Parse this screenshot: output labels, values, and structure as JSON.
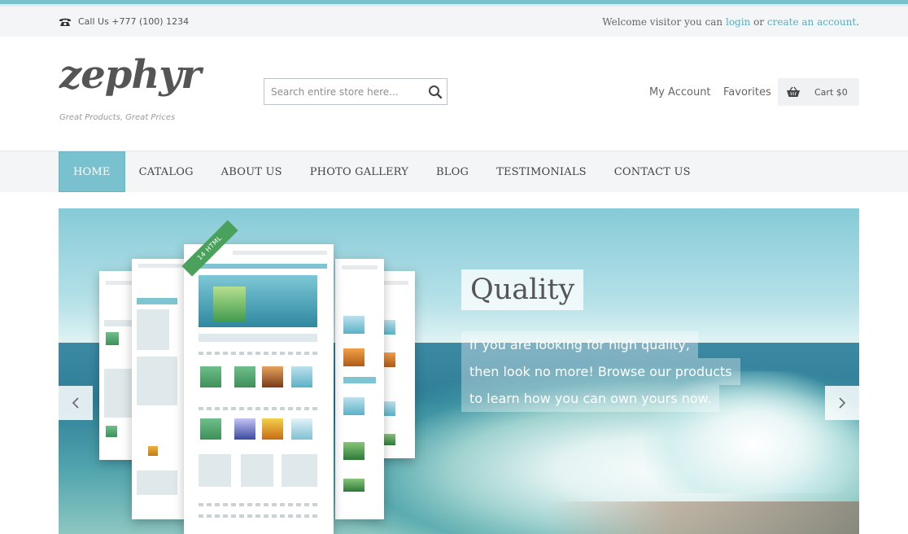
{
  "topbar": {
    "phone": "Call Us +777 (100) 1234",
    "welcome_prefix": "Welcome visitor you can",
    "login": "login",
    "or": "or",
    "create_account": "create an account",
    "period": "."
  },
  "header": {
    "logo": "zephyr",
    "tagline": "Great Products, Great Prices",
    "search_placeholder": "Search entire store here...",
    "my_account": "My Account",
    "favorites": "Favorites",
    "cart": "Cart $0"
  },
  "nav": {
    "items": [
      "HOME",
      "CATALOG",
      "ABOUT US",
      "PHOTO GALLERY",
      "BLOG",
      "TESTIMONIALS",
      "CONTACT US"
    ],
    "active": "HOME"
  },
  "slider": {
    "title": "Quality",
    "lines": [
      "If you are looking for high quality,",
      "then look no more! Browse our products",
      "to learn how you can own yours now."
    ],
    "ribbon": "14 HTML"
  },
  "colors": {
    "accent": "#79c1cf",
    "link": "#52b0c2",
    "topbar_bg": "#f4f5f7"
  },
  "icons": {
    "phone": "phone-icon",
    "search": "search-icon",
    "cart": "basket-icon",
    "prev": "chevron-left-icon",
    "next": "chevron-right-icon"
  }
}
